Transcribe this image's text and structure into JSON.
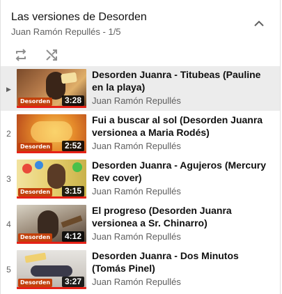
{
  "playlist": {
    "title": "Las versiones de Desorden",
    "subtitle": "Juan Ramón Repullés - 1/5"
  },
  "icons": {
    "collapse": "chevron-up-icon",
    "loop": "repeat-icon",
    "shuffle": "shuffle-icon",
    "now_playing": "play-triangle-icon"
  },
  "colors": {
    "active_row": "#ececec",
    "progress_red": "#e62117",
    "brand_orange": "#c2410c"
  },
  "items": [
    {
      "index": "▶",
      "title": "Desorden Juanra - Titubeas (Pauline en la playa)",
      "channel": "Juan Ramón Repullés",
      "duration": "3:28",
      "active": true
    },
    {
      "index": "2",
      "title": "Fui a buscar al sol (Desorden Juanra versionea a Maria Rodés)",
      "channel": "Juan Ramón Repullés",
      "duration": "2:52",
      "active": false
    },
    {
      "index": "3",
      "title": "Desorden Juanra - Agujeros (Mercury Rev cover)",
      "channel": "Juan Ramón Repullés",
      "duration": "3:15",
      "active": false
    },
    {
      "index": "4",
      "title": "El progreso (Desorden Juanra versionea a Sr. Chinarro)",
      "channel": "Juan Ramón Repullés",
      "duration": "4:12",
      "active": false
    },
    {
      "index": "5",
      "title": "Desorden Juanra - Dos Minutos (Tomás Pinel)",
      "channel": "Juan Ramón Repullés",
      "duration": "3:27",
      "active": false
    }
  ]
}
